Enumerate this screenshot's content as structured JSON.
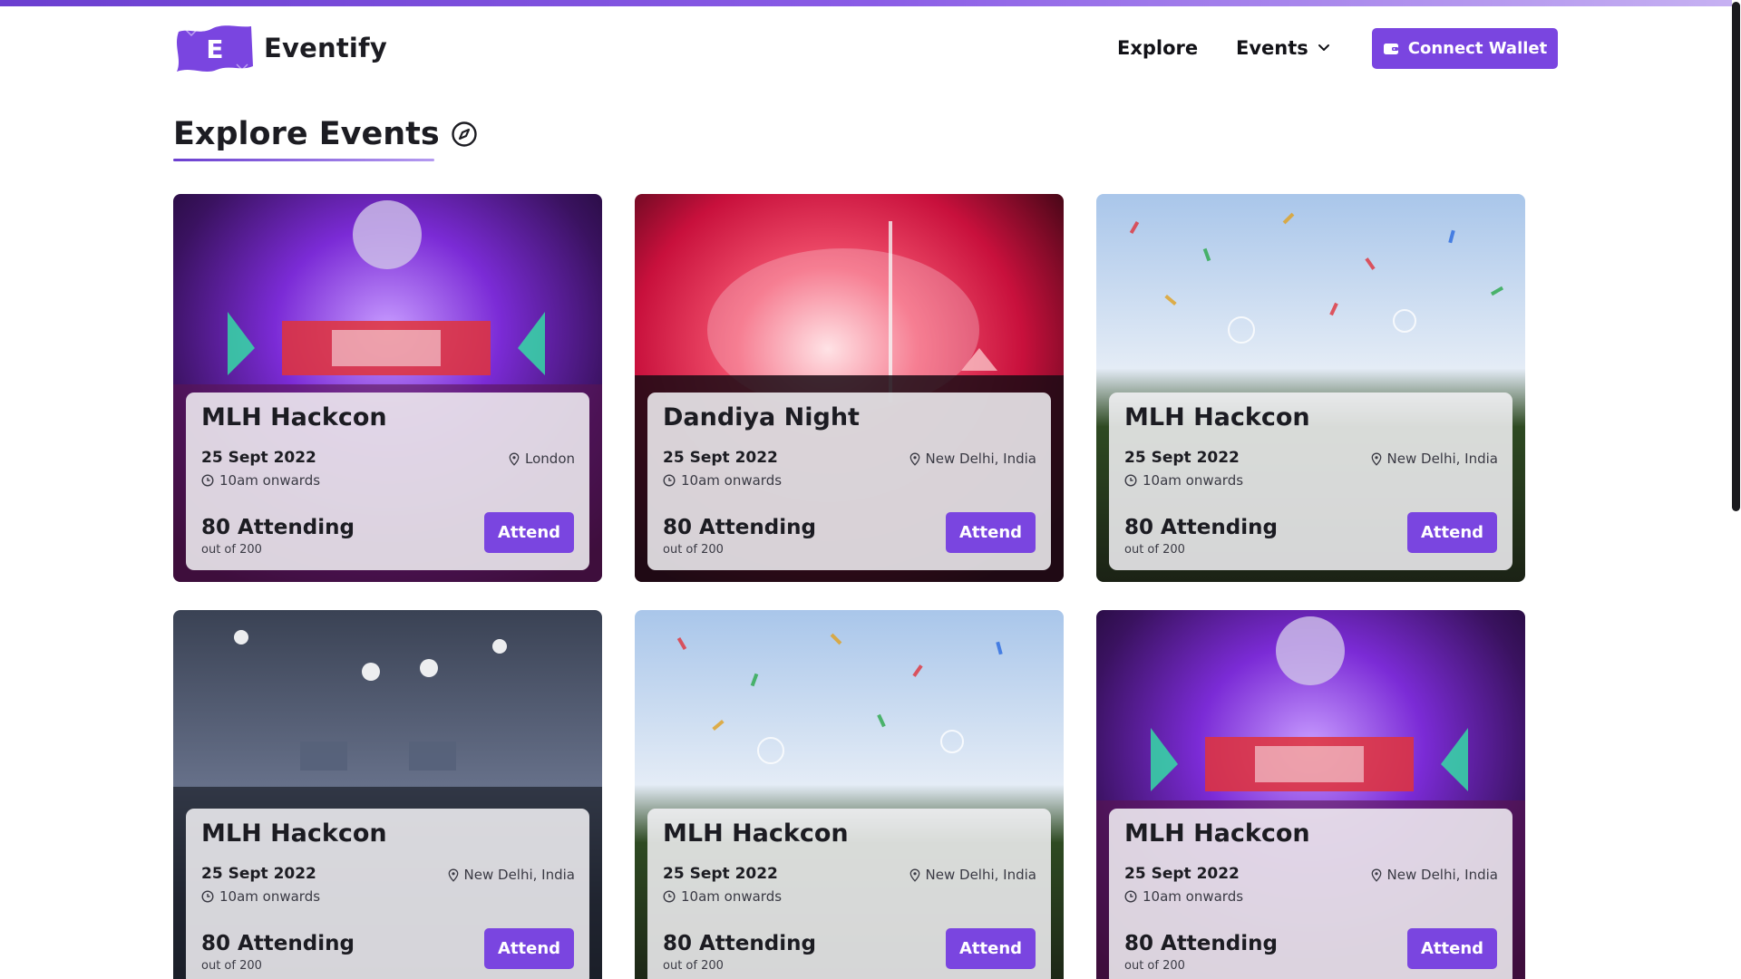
{
  "app": {
    "brand": "Eventify",
    "logo_letter": "E",
    "accent_color": "#7a45e0"
  },
  "header": {
    "nav": {
      "explore": "Explore",
      "events": "Events"
    },
    "connect_wallet": "Connect Wallet"
  },
  "page": {
    "title": "Explore Events"
  },
  "events": [
    {
      "title": "MLH Hackcon",
      "date": "25 Sept 2022",
      "time": "10am onwards",
      "location": "London",
      "attending": "80 Attending",
      "capacity": "out of 200",
      "action": "Attend",
      "image": "disco-ball-stage"
    },
    {
      "title": "Dandiya Night",
      "date": "25 Sept 2022",
      "time": "10am onwards",
      "location": "New Delhi, India",
      "attending": "80 Attending",
      "capacity": "out of 200",
      "action": "Attend",
      "image": "red-smoke-concert"
    },
    {
      "title": "MLH Hackcon",
      "date": "25 Sept 2022",
      "time": "10am onwards",
      "location": "New Delhi, India",
      "attending": "80 Attending",
      "capacity": "out of 200",
      "action": "Attend",
      "image": "juggling-festival"
    },
    {
      "title": "MLH Hackcon",
      "date": "25 Sept 2022",
      "time": "10am onwards",
      "location": "New Delhi, India",
      "attending": "80 Attending",
      "capacity": "out of 200",
      "action": "Attend",
      "image": "conference-hall"
    },
    {
      "title": "MLH Hackcon",
      "date": "25 Sept 2022",
      "time": "10am onwards",
      "location": "New Delhi, India",
      "attending": "80 Attending",
      "capacity": "out of 200",
      "action": "Attend",
      "image": "juggling-festival"
    },
    {
      "title": "MLH Hackcon",
      "date": "25 Sept 2022",
      "time": "10am onwards",
      "location": "New Delhi, India",
      "attending": "80 Attending",
      "capacity": "out of 200",
      "action": "Attend",
      "image": "disco-ball-stage"
    }
  ]
}
